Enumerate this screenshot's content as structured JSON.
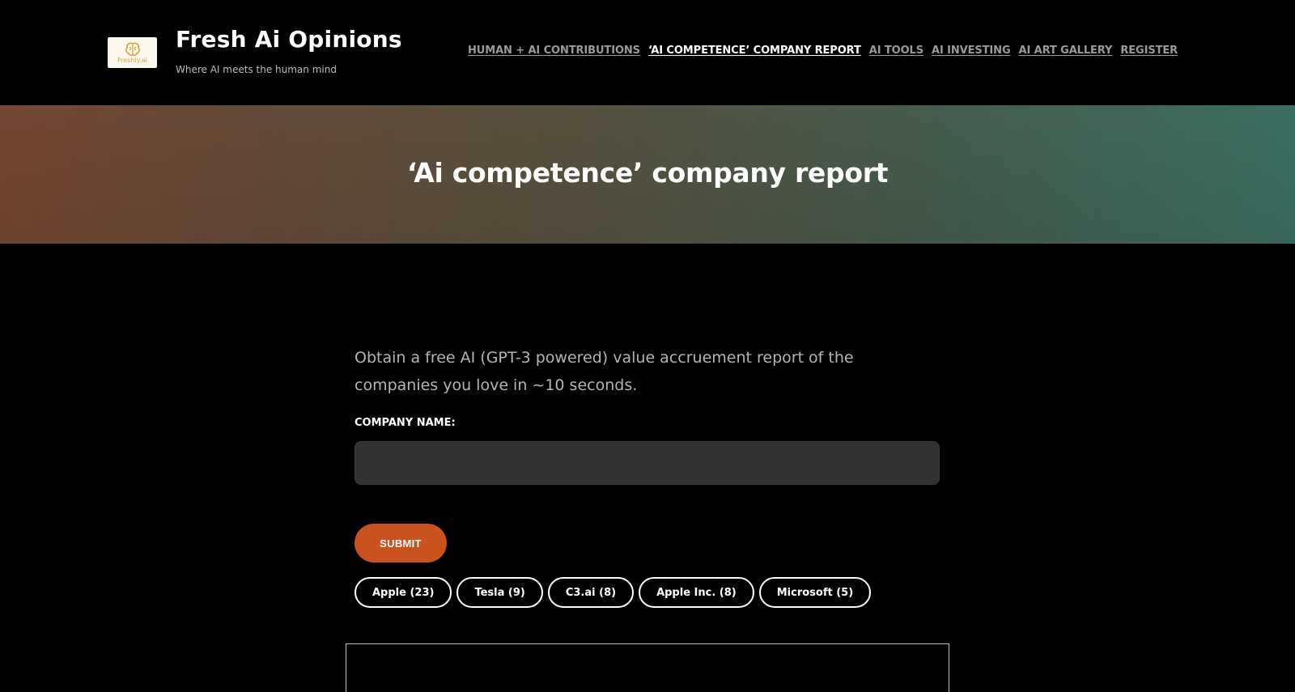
{
  "site": {
    "title": "Fresh Ai Opinions",
    "tagline": "Where AI meets the human mind",
    "logo_text": "Freshly.ai",
    "logo_color": "#d4a33a"
  },
  "nav": {
    "items": [
      {
        "label": "HUMAN + AI CONTRIBUTIONS",
        "active": false
      },
      {
        "label": "‘AI COMPETENCE’ COMPANY REPORT",
        "active": true
      },
      {
        "label": "AI TOOLS",
        "active": false
      },
      {
        "label": "AI INVESTING",
        "active": false
      },
      {
        "label": "AI ART GALLERY",
        "active": false
      },
      {
        "label": "REGISTER",
        "active": false
      }
    ]
  },
  "hero": {
    "title": "‘Ai competence’ company report"
  },
  "form": {
    "intro": "Obtain a free AI (GPT-3 powered) value accruement report of the companies you love in ~10 seconds.",
    "company_label": "COMPANY NAME:",
    "company_value": "",
    "submit_label": "SUBMIT",
    "submit_color": "#c9521f"
  },
  "suggestions": [
    "Apple (23)",
    "Tesla (9)",
    "C3.ai (8)",
    "Apple Inc. (8)",
    "Microsoft (5)"
  ]
}
